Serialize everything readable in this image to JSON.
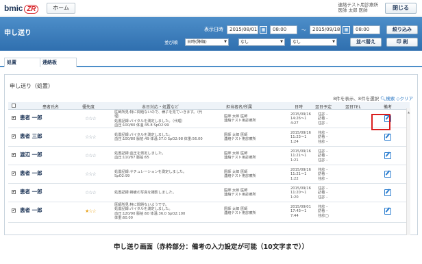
{
  "app": {
    "logo_text": "bmic",
    "logo_mark": "ZR"
  },
  "topbar": {
    "home_label": "ホーム",
    "user_line1": "連絡テスト用診療所",
    "user_line2": "医師 太郎 医師",
    "close_label": "閉じる"
  },
  "header": {
    "title": "申し送り",
    "date_label": "表示日時",
    "date_from": "2015/08/01",
    "time_from": "08:00",
    "tilde": "〜",
    "date_to": "2015/09/18",
    "time_to": "08:00",
    "filter_label": "絞り込み",
    "sort_label": "並び順",
    "sort_selects": [
      "日時(降順)",
      "なし",
      "なし"
    ],
    "sort_button": "並べ替え",
    "print_button": "印 刷"
  },
  "tabs": [
    {
      "label": "処置"
    },
    {
      "label": "連絡板"
    }
  ],
  "panel": {
    "title": "申し送り（処置）",
    "summary": "8件を表示、8件を選択",
    "search_link": "検索",
    "clear_link": "クリア"
  },
  "table": {
    "columns": [
      "患者氏名",
      "優先度",
      "本日対応・処置など",
      "担当者名/所属",
      "日時",
      "翌日予定",
      "翌日TEL",
      "備考"
    ],
    "rows": [
      {
        "checked": "✔",
        "name": "患者 一郎",
        "stars": "☆☆☆",
        "star_color": "#8a97a5",
        "content": "医師所見:特に問題ないので、様子を見ていきます。（代\n理）\n処置記録:バイタルを測定しました。（代理）\n血圧:100/80 体温:35.8 SpO2:99",
        "staff": "医師 太郎 医師\n連絡テスト用診療所",
        "datetime": "2015/09/16\n14:26〜1\n4:27",
        "plan": "往診 –\n訪看 –\n往診 –"
      },
      {
        "checked": "✔",
        "name": "患者 三郎",
        "stars": "☆☆☆",
        "star_color": "#8a97a5",
        "content": "処置記録:バイタルを測定しました。\n血圧:100/80 脈拍:49 体温:37.0 SpO2:98 体重:56.00",
        "staff": "医師 太郎 医師\n連絡テスト用診療所",
        "datetime": "2015/09/16\n11:23〜1\n1:24",
        "plan": "往診 –\n訪看 –\n往診 –"
      },
      {
        "checked": "✔",
        "name": "渡辺 一郎",
        "stars": "☆☆☆",
        "star_color": "#8a97a5",
        "content": "処置記録:血圧を測定しました。\n血圧:110/87 脈拍:65",
        "staff": "医師 太郎 医師\n連絡テスト用診療所",
        "datetime": "2015/09/16\n11:21〜1\n1:21",
        "plan": "往診 –\n訪看 –\n往診 –"
      },
      {
        "checked": "✔",
        "name": "患者 一郎",
        "stars": "☆☆☆",
        "star_color": "#8a97a5",
        "content": "処置記録:サチュレーションを測定しました。\nSpO2:99",
        "staff": "医師 太郎 医師\n連絡テスト用診療所",
        "datetime": "2015/09/16\n11:21〜1\n1:22",
        "plan": "往診 –\n訪看 –\n往診 –"
      },
      {
        "checked": "✔",
        "name": "患者 一郎",
        "stars": "☆☆☆",
        "star_color": "#8a97a5",
        "content": "処置記録:褥瘡の写真を撮影しました。",
        "staff": "医師 太郎 医師\n連絡テスト用診療所",
        "datetime": "2015/09/16\n11:20〜1\n1:20",
        "plan": "往診 –\n訪看 –\n往診 –"
      },
      {
        "checked": "✔",
        "name": "患者 一郎",
        "stars": "★☆☆",
        "star_color": "#e8a31c",
        "content": "医師所見:特に問題ないようです。\n処置記録:バイタルを測定しました。\n血圧:120/90 脈拍:60 体温:36.0 SpO2:100\n体重:60.00",
        "staff": "医師 太郎 医師\n連絡テスト用診療所",
        "datetime": "2015/09/01\n17:43〜1\n7:44",
        "plan": "往診 –\n訪看 –\n往診◯"
      }
    ]
  },
  "caption": "申し送り画面（赤枠部分：備考の入力設定が可能（10文字まで））"
}
